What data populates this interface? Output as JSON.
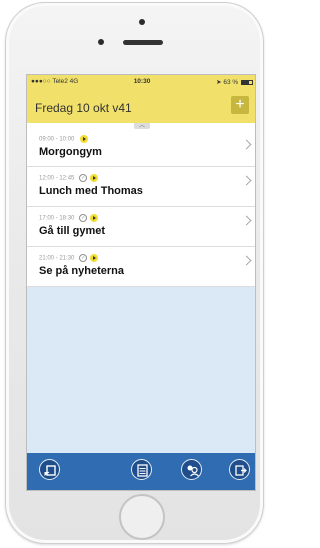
{
  "status_bar": {
    "carrier": "●●●○○ Tele2",
    "network": "4G",
    "time": "10:30",
    "battery": "63 %"
  },
  "header": {
    "title": "Fredag 10 okt v41",
    "add_label": "+"
  },
  "pull_tab": "︿",
  "items": [
    {
      "time": "09:00 - 10:00",
      "title": "Morgongym",
      "checked": false
    },
    {
      "time": "12:00 - 12:45",
      "title": "Lunch med Thomas",
      "checked": true
    },
    {
      "time": "17:00 - 18:30",
      "title": "Gå till gymet",
      "checked": true
    },
    {
      "time": "21:00 - 21:30",
      "title": "Se på nyheterna",
      "checked": true
    }
  ],
  "tab_bar": {
    "icons": [
      "back-book-icon",
      "calendar-list-icon",
      "contacts-icon",
      "exit-icon"
    ]
  },
  "colors": {
    "header": "#f1e16b",
    "tab_bar": "#2f6cb1",
    "empty_area": "#dbe9f7"
  }
}
